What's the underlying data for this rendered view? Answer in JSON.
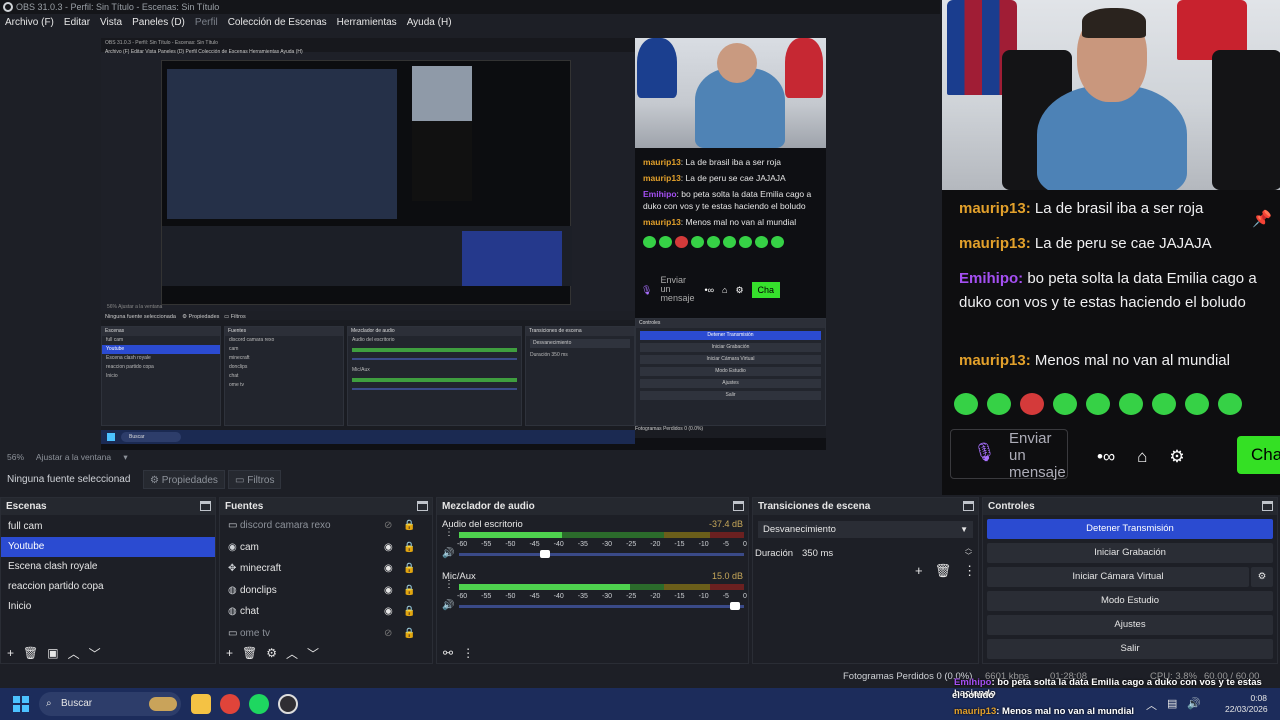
{
  "window": {
    "title": "OBS 31.0.3 - Perfil: Sin Título - Escenas: Sin Título"
  },
  "menu": [
    "Archivo (F)",
    "Editar",
    "Vista",
    "Paneles (D)",
    "Perfil",
    "Colección de Escenas",
    "Herramientas",
    "Ayuda (H)"
  ],
  "preview": {
    "zoom": "56%",
    "fit_label": "Ajustar a la ventana",
    "nested": {
      "title": "OBS 31.0.3 - Perfil: Sin Título - Escenas: Sin Título",
      "menu": "Archivo (F)   Editar   Vista   Paneles (D)   Perfil   Colección de Escenas   Herramientas   Ayuda (H)",
      "docks": [
        {
          "title": "Escenas",
          "rows": [
            "full cam",
            "Youtube",
            "Escena clash royale",
            "reaccion partido copa",
            "Inicio"
          ]
        },
        {
          "title": "Fuentes",
          "rows": [
            "discord camara rexo",
            "cam",
            "minecraft",
            "donclips",
            "chat",
            "ome tv"
          ]
        },
        {
          "title": "Mezclador de audio",
          "rows": [
            "Audio del escritorio",
            "Mic/Aux"
          ]
        },
        {
          "title": "Transiciones de escena",
          "rows": [
            "Desvanecimiento",
            "Duración  350 ms"
          ]
        },
        {
          "title": "Controles",
          "rows": [
            "Detener Transmisión",
            "Iniciar Grabación",
            "Iniciar Cámara Virtual",
            "Modo Estudio",
            "Ajustes",
            "Salir"
          ]
        }
      ],
      "no_source": "Ninguna fuente seleccionada",
      "tab_props": "Propiedades",
      "tab_filters": "Filtros",
      "status": "Fotogramas Perdidos 0 (0.0%)",
      "task_search": "Buscar",
      "zoom": "56%",
      "fit": "Ajustar a la ventana"
    },
    "chat": [
      {
        "user": "mauriр13",
        "text": "La de brasil iba a ser roja",
        "color": "orange"
      },
      {
        "user": "maurip13",
        "text": "La de peru se cae JAJAJA",
        "color": "orange"
      },
      {
        "user": "Emihipo",
        "text": "bo peta solta la data Emilia cago a duko con vos y te estas haciendo el boludo",
        "color": "purple"
      },
      {
        "user": "maurip13",
        "text": "Menos mal no van al mundial",
        "color": "orange"
      }
    ],
    "input_label": "Enviar un mensaje",
    "chat_button": "Cha"
  },
  "properties_bar": {
    "no_source": "Ninguna fuente seleccionad",
    "properties": "Propiedades",
    "filters": "Filtros"
  },
  "scenes": {
    "title": "Escenas",
    "items": [
      "full cam",
      "Youtube",
      "Escena clash royale",
      "reaccion partido copa",
      "Inicio"
    ],
    "selected": 1
  },
  "sources": {
    "title": "Fuentes",
    "items": [
      {
        "name": "discord camara rexo",
        "icon": "window-icon",
        "visible": false
      },
      {
        "name": "cam",
        "icon": "camera-icon",
        "visible": true
      },
      {
        "name": "minecraft",
        "icon": "gamepad-icon",
        "visible": true
      },
      {
        "name": "donclips",
        "icon": "globe-icon",
        "visible": true
      },
      {
        "name": "chat",
        "icon": "globe-icon",
        "visible": true
      },
      {
        "name": "ome tv",
        "icon": "window-icon",
        "visible": false
      }
    ]
  },
  "mixer": {
    "title": "Mezclador de audio",
    "channels": [
      {
        "name": "Audio del escritorio",
        "db": "-37.4 dB",
        "level": 0.36,
        "volume": 0.3
      },
      {
        "name": "Mic/Aux",
        "db": "15.0 dB",
        "level": 0.6,
        "volume": 0.97
      }
    ],
    "ticks": [
      "-60",
      "-55",
      "-50",
      "-45",
      "-40",
      "-35",
      "-30",
      "-25",
      "-20",
      "-15",
      "-10",
      "-5",
      "0"
    ]
  },
  "transitions": {
    "title": "Transiciones de escena",
    "type": "Desvanecimiento",
    "duration_label": "Duración",
    "duration": "350 ms"
  },
  "controls": {
    "title": "Controles",
    "buttons": [
      "Detener Transmisión",
      "Iniciar Grabación",
      "Iniciar Cámara Virtual",
      "Modo Estudio",
      "Ajustes",
      "Salir"
    ]
  },
  "chat": {
    "messages": [
      {
        "user": "maurip13",
        "text": "La de brasil iba a ser roja",
        "color": "#e2a02b"
      },
      {
        "user": "maurip13",
        "text": "La de peru se cae JAJAJA",
        "color": "#e2a02b"
      },
      {
        "user": "Emihipo",
        "text": "bo peta solta la data Emilia cago a duko con vos y te estas haciendo el boludo",
        "color": "#a44ff2"
      },
      {
        "user": "maurip13",
        "text": "Menos mal no van al mundial",
        "color": "#e2a02b"
      }
    ],
    "input_placeholder": "Enviar un mensaje",
    "send_button": "Cha"
  },
  "statusbar": {
    "dropped": "Fotogramas Perdidos 0 (0.0%)",
    "bitrate": "6601 kbps",
    "stream_time": "01:28:08",
    "cpu": "CPU: 3.8%",
    "fps": "60.00 / 60.00 FPS"
  },
  "overlay": {
    "line1_user": "Emihipo",
    "line1_text": ": bo peta solta la data Emilia cago a duko con vos y te estas haciendo",
    "line2": "el boludo",
    "line3_user": "maurip13",
    "line3_text": ": Menos mal no van al mundial"
  },
  "taskbar": {
    "search": "Buscar",
    "time": "0:08",
    "date": "22/03/2026"
  }
}
